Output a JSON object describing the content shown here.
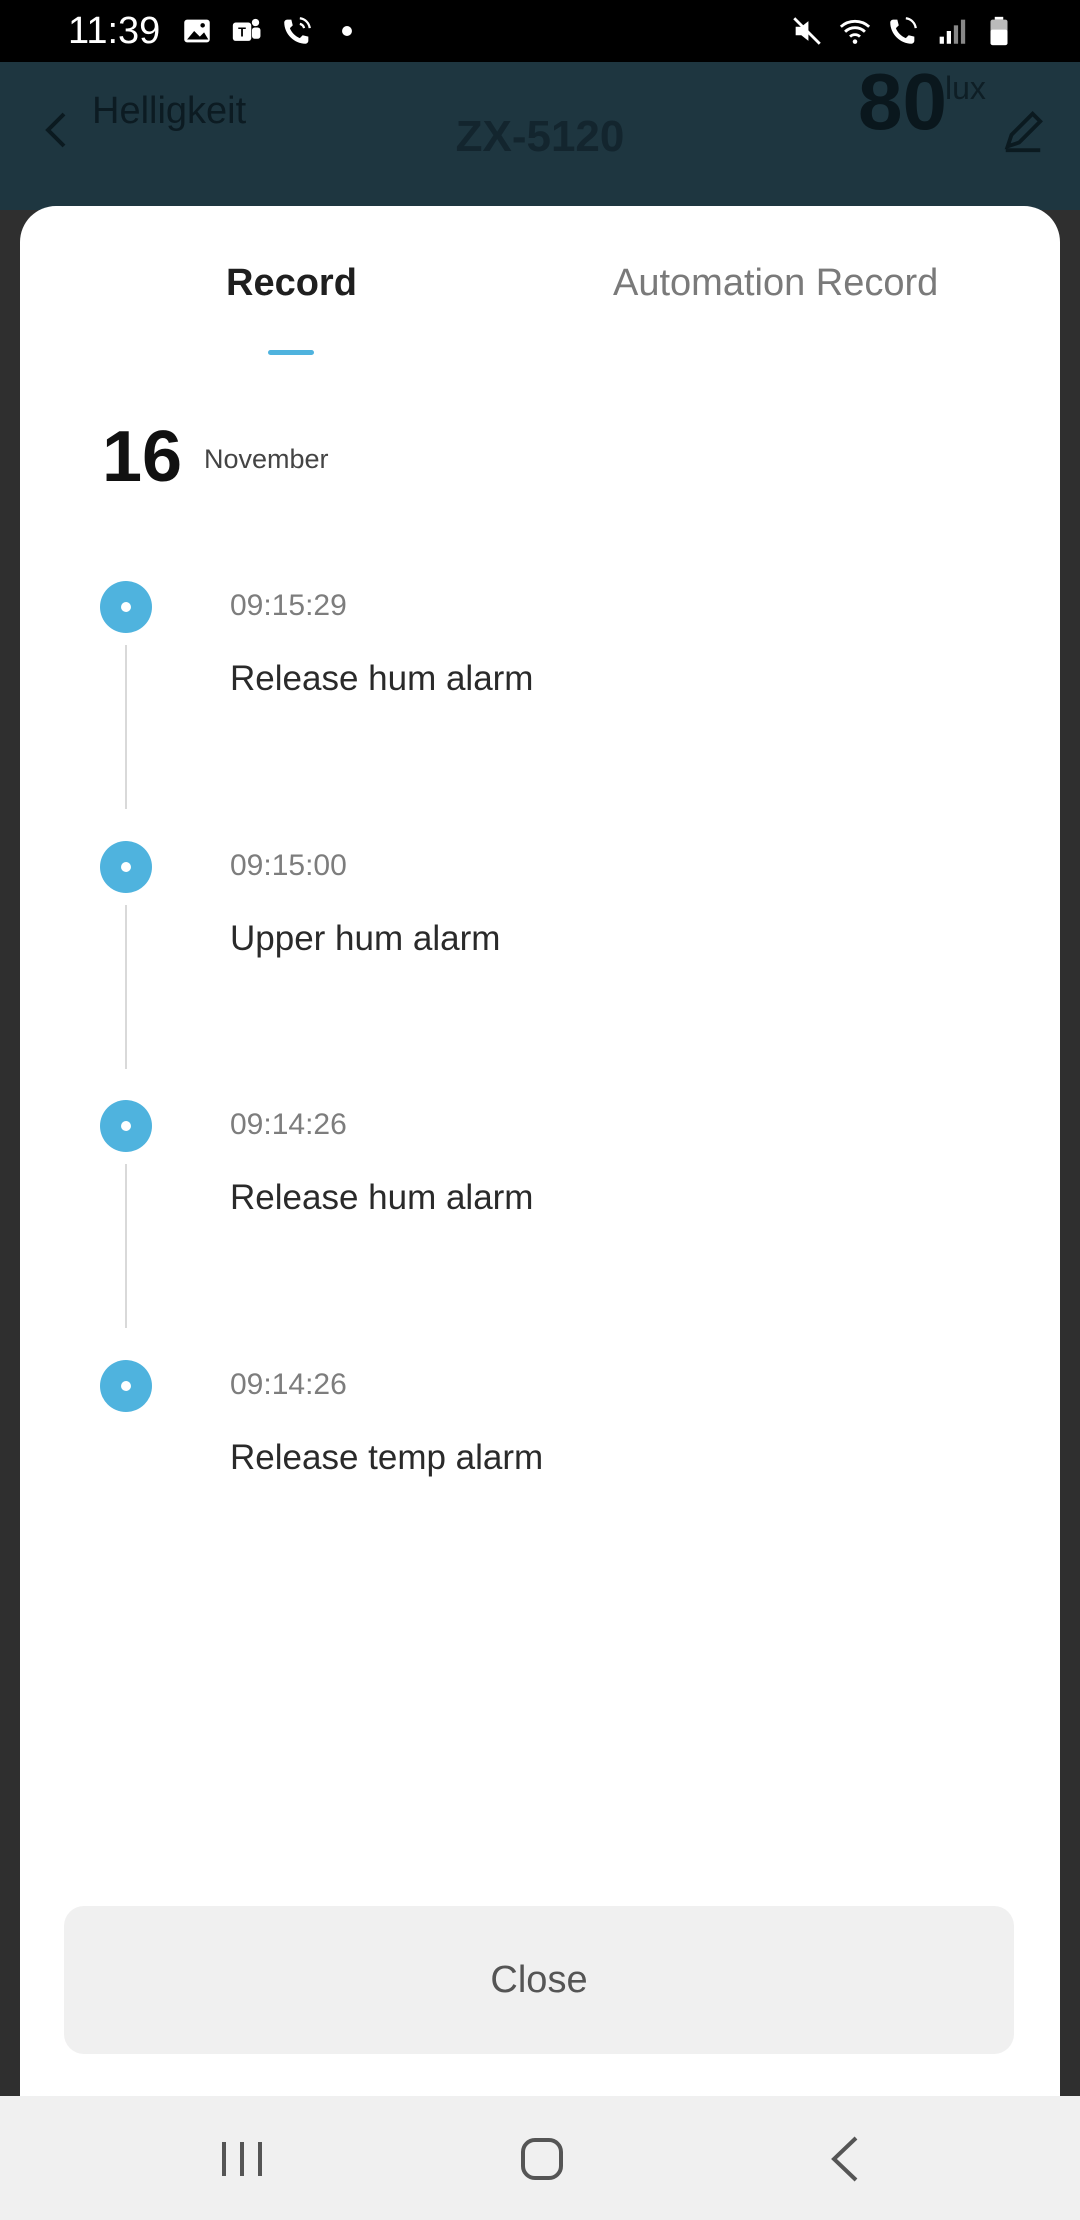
{
  "status_bar": {
    "time": "11:39",
    "left_icons": [
      "gallery-icon",
      "teams-icon",
      "wifi-call-icon",
      "dot-icon"
    ],
    "right_icons": [
      "mute-icon",
      "wifi-icon",
      "wifi-call-icon",
      "signal-icon",
      "battery-icon"
    ]
  },
  "background_app": {
    "subtitle": "Helligkeit",
    "title": "ZX-5120",
    "value": "80",
    "unit": "lux",
    "icons": [
      "back-icon",
      "edit-icon"
    ]
  },
  "sheet": {
    "tabs": [
      {
        "label": "Record",
        "active": true
      },
      {
        "label": "Automation Record",
        "active": false
      }
    ],
    "date": {
      "day": "16",
      "month": "November"
    },
    "records": [
      {
        "time": "09:15:29",
        "text": "Release hum alarm"
      },
      {
        "time": "09:15:00",
        "text": "Upper hum alarm"
      },
      {
        "time": "09:14:26",
        "text": "Release hum alarm"
      },
      {
        "time": "09:14:26",
        "text": "Release temp alarm"
      }
    ],
    "close_label": "Close"
  },
  "nav_bar": {
    "icons": [
      "recent-apps-icon",
      "home-icon",
      "back-icon"
    ]
  },
  "colors": {
    "accent": "#4fb3de",
    "overlay_header": "#1e3640",
    "close_button_bg": "#f0f0f0"
  }
}
